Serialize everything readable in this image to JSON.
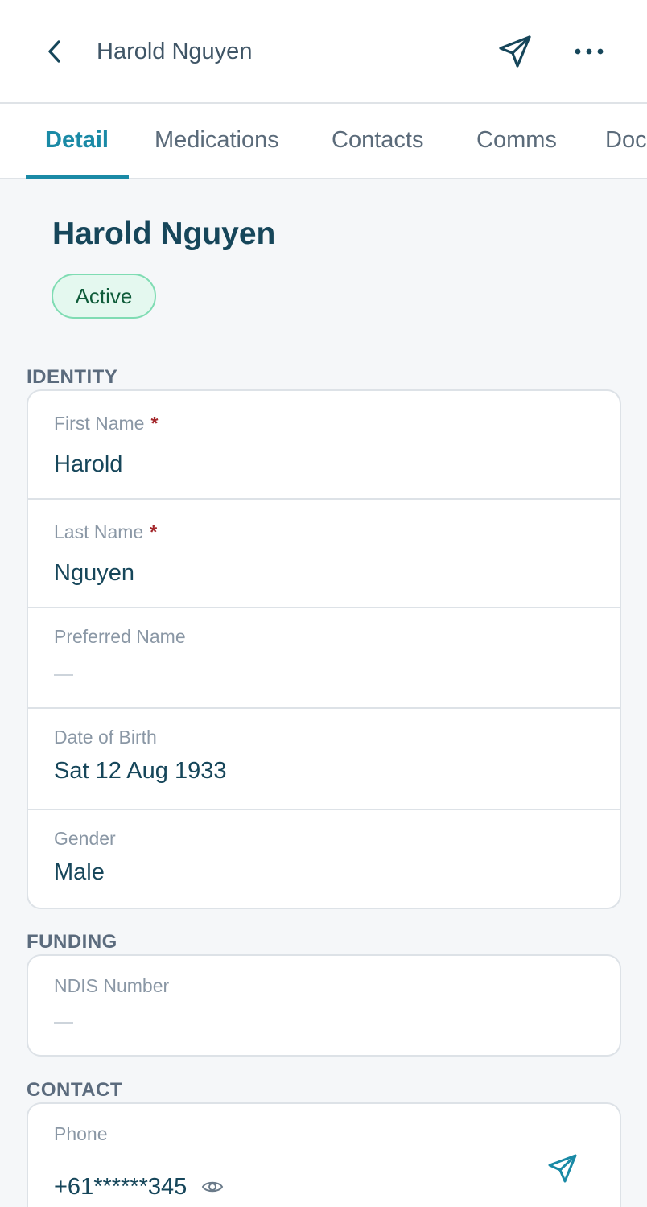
{
  "header": {
    "title": "Harold Nguyen"
  },
  "tabs": [
    {
      "label": "Detail",
      "active": true
    },
    {
      "label": "Medications",
      "active": false
    },
    {
      "label": "Contacts",
      "active": false
    },
    {
      "label": "Comms",
      "active": false
    },
    {
      "label": "Documents",
      "active": false
    }
  ],
  "profile": {
    "name": "Harold Nguyen",
    "status": "Active"
  },
  "sections": {
    "identity": {
      "heading": "IDENTITY",
      "fields": {
        "first_name": {
          "label": "First Name",
          "required_mark": "*",
          "value": "Harold"
        },
        "last_name": {
          "label": "Last Name",
          "required_mark": "*",
          "value": "Nguyen"
        },
        "preferred_name": {
          "label": "Preferred Name",
          "value": ""
        },
        "date_of_birth": {
          "label": "Date of Birth",
          "value": "Sat 12 Aug 1933"
        },
        "gender": {
          "label": "Gender",
          "value": "Male"
        }
      }
    },
    "funding": {
      "heading": "FUNDING",
      "fields": {
        "ndis_number": {
          "label": "NDIS Number",
          "value": ""
        }
      }
    },
    "contact": {
      "heading": "CONTACT",
      "fields": {
        "phone": {
          "label": "Phone",
          "value": "+61******345"
        }
      }
    }
  },
  "icons": {
    "back": "chevron-left-icon",
    "send": "send-icon",
    "more": "more-horizontal-icon",
    "reveal": "eye-icon"
  },
  "colors": {
    "accent": "#1a8aa6",
    "text_primary": "#16465a",
    "label": "#8a97a5",
    "status_bg": "#e4f8ef",
    "status_border": "#7fdcb3",
    "required": "#a3262a"
  }
}
